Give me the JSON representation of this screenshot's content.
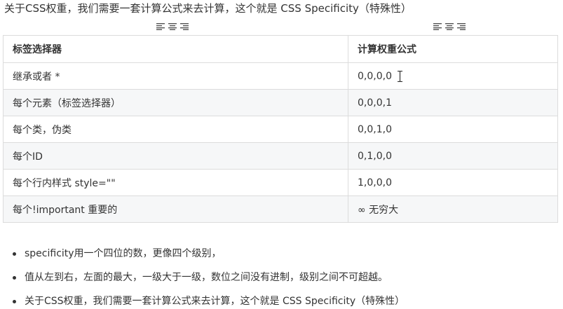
{
  "intro_text": "关于CSS权重，我们需要一套计算公式来去计算，这个就是 CSS Specificity（特殊性）",
  "toolbar_icons": [
    "align-left-icon",
    "align-center-icon",
    "align-right-icon"
  ],
  "table": {
    "headers": [
      "标签选择器",
      "计算权重公式"
    ],
    "rows": [
      [
        "继承或者 *",
        "0,0,0,0"
      ],
      [
        "每个元素（标签选择器）",
        "0,0,0,1"
      ],
      [
        "每个类，伪类",
        "0,0,1,0"
      ],
      [
        "每个ID",
        "0,1,0,0"
      ],
      [
        "每个行内样式 style=\"\"",
        "1,0,0,0"
      ],
      [
        "每个!important  重要的",
        "∞ 无穷大"
      ]
    ]
  },
  "bullets": [
    "specificity用一个四位的数，更像四个级别，",
    "值从左到右，左面的最大，一级大于一级，数位之间没有进制，级别之间不可超越。",
    "关于CSS权重，我们需要一套计算公式来去计算，这个就是 CSS Specificity（特殊性）"
  ]
}
